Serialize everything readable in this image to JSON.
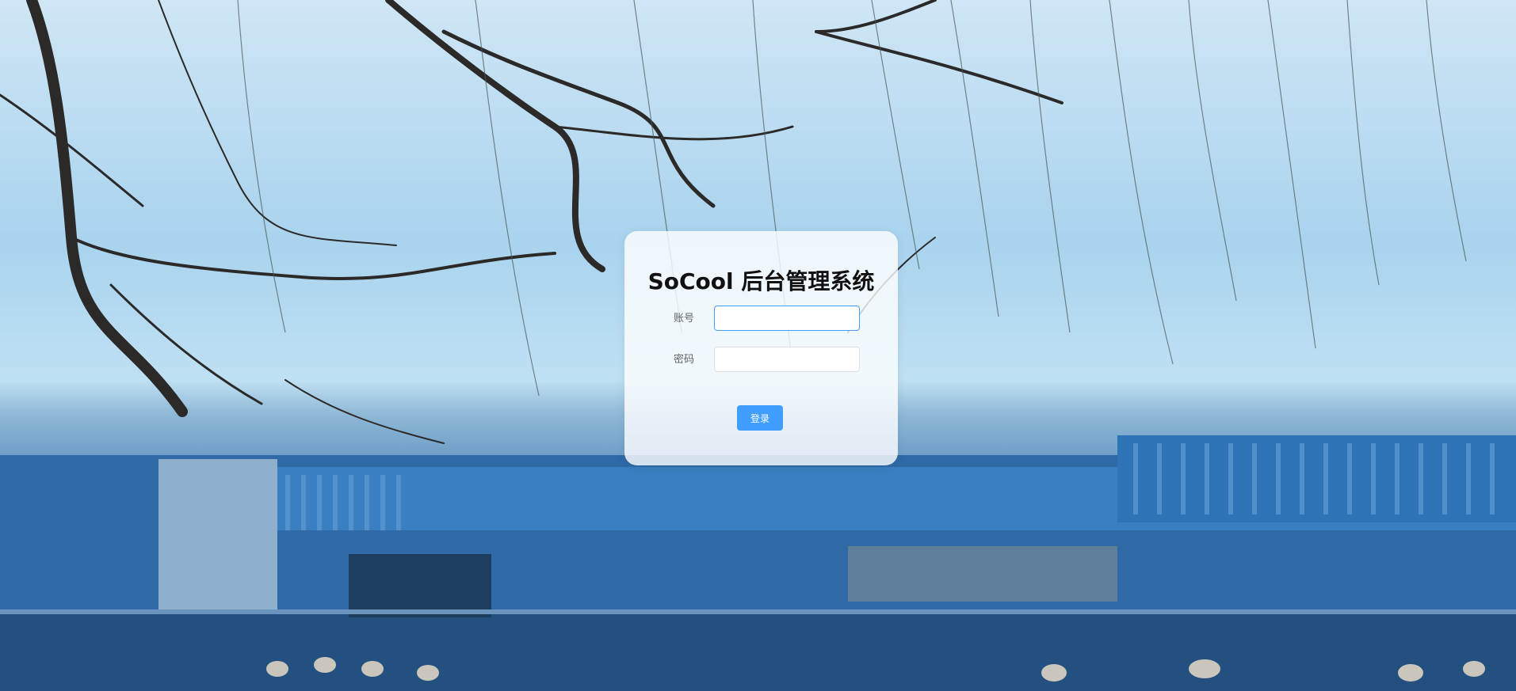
{
  "login": {
    "title": "SoCool 后台管理系统",
    "account_label": "账号",
    "account_value": "",
    "password_label": "密码",
    "password_value": "",
    "submit_label": "登录"
  },
  "colors": {
    "primary": "#409eff",
    "input_border": "#dcdfe6",
    "label": "#606266"
  }
}
